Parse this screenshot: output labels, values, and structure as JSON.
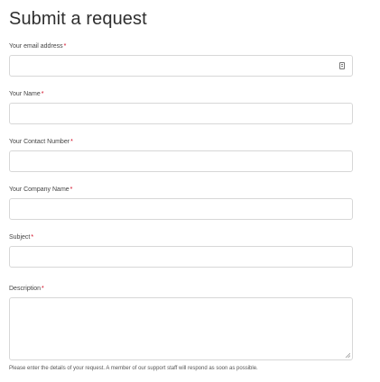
{
  "form": {
    "title": "Submit a request",
    "required_marker": "*",
    "fields": {
      "email": {
        "label": "Your email address",
        "value": ""
      },
      "name": {
        "label": "Your Name",
        "value": ""
      },
      "contact": {
        "label": "Your Contact Number",
        "value": ""
      },
      "company": {
        "label": "Your Company Name",
        "value": ""
      },
      "subject": {
        "label": "Subject",
        "value": ""
      },
      "description": {
        "label": "Description",
        "value": "",
        "help": "Please enter the details of your request. A member of our support staff will respond as soon as possible."
      }
    },
    "icons": {
      "email_field": "autofill-contact-card-icon",
      "description_field": "resize-handle-icon"
    }
  }
}
